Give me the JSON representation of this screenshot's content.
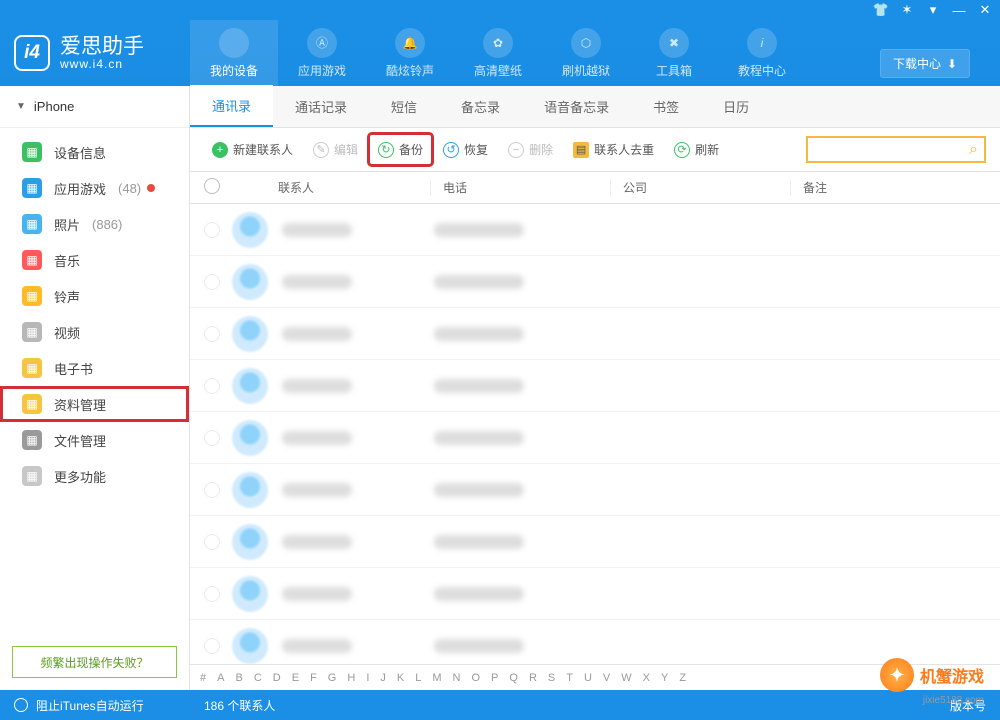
{
  "titlebar": {
    "icons": [
      "tshirt",
      "gear",
      "dropdown",
      "min",
      "close"
    ]
  },
  "logo": {
    "badge": "i4",
    "title": "爱思助手",
    "sub": "www.i4.cn"
  },
  "download_btn": "下载中心",
  "nav": [
    {
      "label": "我的设备",
      "icon": "apple"
    },
    {
      "label": "应用游戏",
      "icon": "app"
    },
    {
      "label": "酷炫铃声",
      "icon": "bell"
    },
    {
      "label": "高清壁纸",
      "icon": "flower"
    },
    {
      "label": "刷机越狱",
      "icon": "box"
    },
    {
      "label": "工具箱",
      "icon": "wrench"
    },
    {
      "label": "教程中心",
      "icon": "info"
    }
  ],
  "device_name": "iPhone",
  "sidebar": [
    {
      "label": "设备信息",
      "icon_bg": "#3cc162",
      "count": ""
    },
    {
      "label": "应用游戏",
      "icon_bg": "#2a9fe8",
      "count": "(48)",
      "dot": true
    },
    {
      "label": "照片",
      "icon_bg": "#46b4ee",
      "count": "(886)"
    },
    {
      "label": "音乐",
      "icon_bg": "#ff5a5a",
      "count": ""
    },
    {
      "label": "铃声",
      "icon_bg": "#ffba26",
      "count": ""
    },
    {
      "label": "视频",
      "icon_bg": "#b8b8b8",
      "count": ""
    },
    {
      "label": "电子书",
      "icon_bg": "#f5c542",
      "count": ""
    },
    {
      "label": "资料管理",
      "icon_bg": "#f5c542",
      "count": "",
      "selected": true
    },
    {
      "label": "文件管理",
      "icon_bg": "#9a9a9a",
      "count": ""
    },
    {
      "label": "更多功能",
      "icon_bg": "#c8c8c8",
      "count": ""
    }
  ],
  "help_btn": "频繁出现操作失败？",
  "tabs": [
    "通讯录",
    "通话记录",
    "短信",
    "备忘录",
    "语音备忘录",
    "书签",
    "日历"
  ],
  "toolbar": {
    "new_contact": "新建联系人",
    "edit": "编辑",
    "backup": "备份",
    "restore": "恢复",
    "delete": "删除",
    "dedupe": "联系人去重",
    "refresh": "刷新"
  },
  "columns": {
    "contact": "联系人",
    "phone": "电话",
    "company": "公司",
    "note": "备注"
  },
  "alpha": [
    "#",
    "A",
    "B",
    "C",
    "D",
    "E",
    "F",
    "G",
    "H",
    "I",
    "J",
    "K",
    "L",
    "M",
    "N",
    "O",
    "P",
    "Q",
    "R",
    "S",
    "T",
    "U",
    "V",
    "W",
    "X",
    "Y",
    "Z"
  ],
  "status": {
    "itunes": "阻止iTunes自动运行",
    "count": "186 个联系人",
    "version_label": "版本号"
  },
  "watermark": {
    "name": "机蟹游戏",
    "url": "jixie5188.com"
  }
}
